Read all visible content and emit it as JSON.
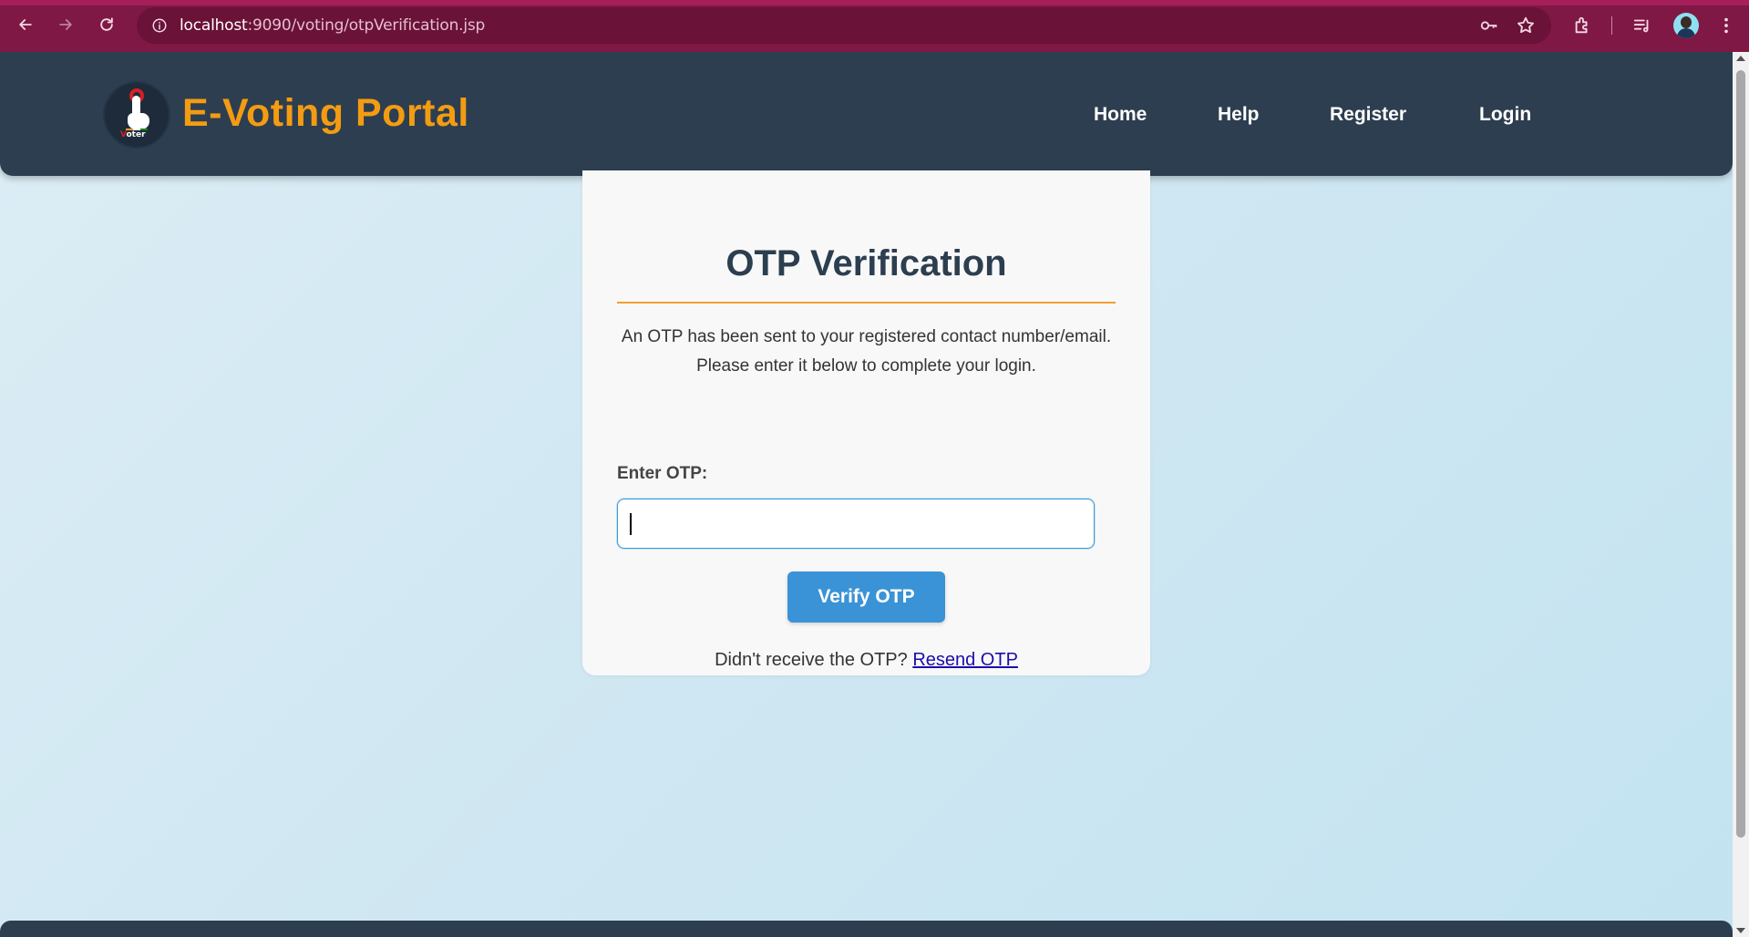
{
  "browser": {
    "url_host": "localhost",
    "url_path": ":9090/voting/otpVerification.jsp"
  },
  "site": {
    "title": "E-Voting Portal",
    "logo_text_first": "V",
    "logo_text_rest": "oter",
    "nav": {
      "home": "Home",
      "help": "Help",
      "register": "Register",
      "login": "Login"
    }
  },
  "otp": {
    "title": "OTP Verification",
    "description": "An OTP has been sent to your registered contact number/email. Please enter it below to complete your login.",
    "label": "Enter OTP:",
    "value": "",
    "button": "Verify OTP",
    "resend_prompt": "Didn't receive the OTP? ",
    "resend_link": "Resend OTP"
  },
  "colors": {
    "chrome": "#7f1845",
    "header": "#2d3e50",
    "brand": "#f39c12",
    "accent": "#3a93d6"
  },
  "icons": [
    "back-icon",
    "forward-icon",
    "reload-icon",
    "site-info-icon",
    "password-key-icon",
    "bookmark-star-icon",
    "extensions-icon",
    "media-controls-icon",
    "profile-avatar",
    "menu-icon"
  ]
}
